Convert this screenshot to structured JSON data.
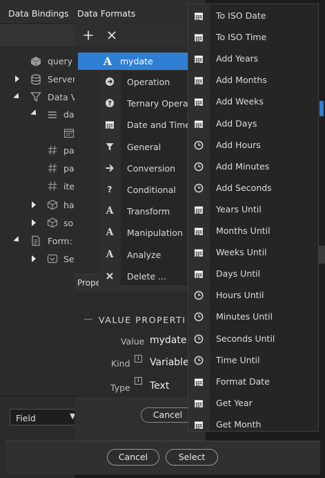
{
  "left_panel": {
    "title": "Data Bindings",
    "tree": [
      {
        "label": "query",
        "icon": "cube-icon"
      },
      {
        "label": "Server",
        "icon": "database-icon"
      },
      {
        "label": "Data V",
        "icon": "filter-icon"
      },
      {
        "label": "da",
        "icon": "list-icon"
      },
      {
        "label": "",
        "icon": "calendar-icon"
      },
      {
        "label": "pa",
        "icon": "hash-icon"
      },
      {
        "label": "pa",
        "icon": "hash-icon"
      },
      {
        "label": "ite",
        "icon": "hash-icon"
      },
      {
        "label": "ha",
        "icon": "cube-outline-icon"
      },
      {
        "label": "so",
        "icon": "cube-outline-icon"
      },
      {
        "label": "Form: f",
        "icon": "form-icon"
      },
      {
        "label": "Se",
        "icon": "select-icon"
      }
    ],
    "field_select": "Field"
  },
  "formats_panel": {
    "title": "Data Formats",
    "selected_item": "mydate",
    "categories": [
      {
        "label": "Operation",
        "icon": "arrow-circle-icon"
      },
      {
        "label": "Ternary Operati",
        "icon": "question-circle-icon"
      },
      {
        "label": "Date and Time",
        "icon": "calendar-icon"
      },
      {
        "label": "General",
        "icon": "filter-icon"
      },
      {
        "label": "Conversion",
        "icon": "arrow-right-icon"
      },
      {
        "label": "Conditional",
        "icon": "question-icon"
      },
      {
        "label": "Transform",
        "icon": "letter-a-icon"
      },
      {
        "label": "Manipulation",
        "icon": "letter-a-icon"
      },
      {
        "label": "Analyze",
        "icon": "letter-a-icon"
      },
      {
        "label": "Delete ...",
        "icon": "close-icon"
      }
    ],
    "properties": {
      "title": "Prope",
      "section_title": "VALUE PROPERTI",
      "value_label": "Value",
      "value": "mydate",
      "kind_label": "Kind",
      "kind": "Variable",
      "type_label": "Type",
      "type": "Text",
      "cancel": "Cancel"
    }
  },
  "date_menu": {
    "items": [
      {
        "label": "To ISO Date",
        "icon": "calendar-icon"
      },
      {
        "label": "To ISO Time",
        "icon": "calendar-icon"
      },
      {
        "label": "Add Years",
        "icon": "calendar-icon"
      },
      {
        "label": "Add Months",
        "icon": "calendar-icon"
      },
      {
        "label": "Add Weeks",
        "icon": "calendar-icon"
      },
      {
        "label": "Add Days",
        "icon": "calendar-icon"
      },
      {
        "label": "Add Hours",
        "icon": "clock-icon"
      },
      {
        "label": "Add Minutes",
        "icon": "clock-icon"
      },
      {
        "label": "Add Seconds",
        "icon": "clock-icon"
      },
      {
        "label": "Years Until",
        "icon": "calendar-icon"
      },
      {
        "label": "Months Until",
        "icon": "calendar-icon"
      },
      {
        "label": "Weeks Until",
        "icon": "calendar-icon"
      },
      {
        "label": "Days Until",
        "icon": "calendar-icon"
      },
      {
        "label": "Hours Until",
        "icon": "clock-icon"
      },
      {
        "label": "Minutes Until",
        "icon": "clock-icon"
      },
      {
        "label": "Seconds Until",
        "icon": "clock-icon"
      },
      {
        "label": "Time Until",
        "icon": "clock-icon"
      },
      {
        "label": "Format Date",
        "icon": "calendar-icon"
      },
      {
        "label": "Get Year",
        "icon": "calendar-icon"
      },
      {
        "label": "Get Month",
        "icon": "calendar-icon"
      }
    ]
  },
  "dialog": {
    "cancel": "Cancel",
    "select": "Select"
  },
  "colors": {
    "accent": "#2f7fd4",
    "background": "#2b2b2b",
    "menu": "#252525"
  }
}
